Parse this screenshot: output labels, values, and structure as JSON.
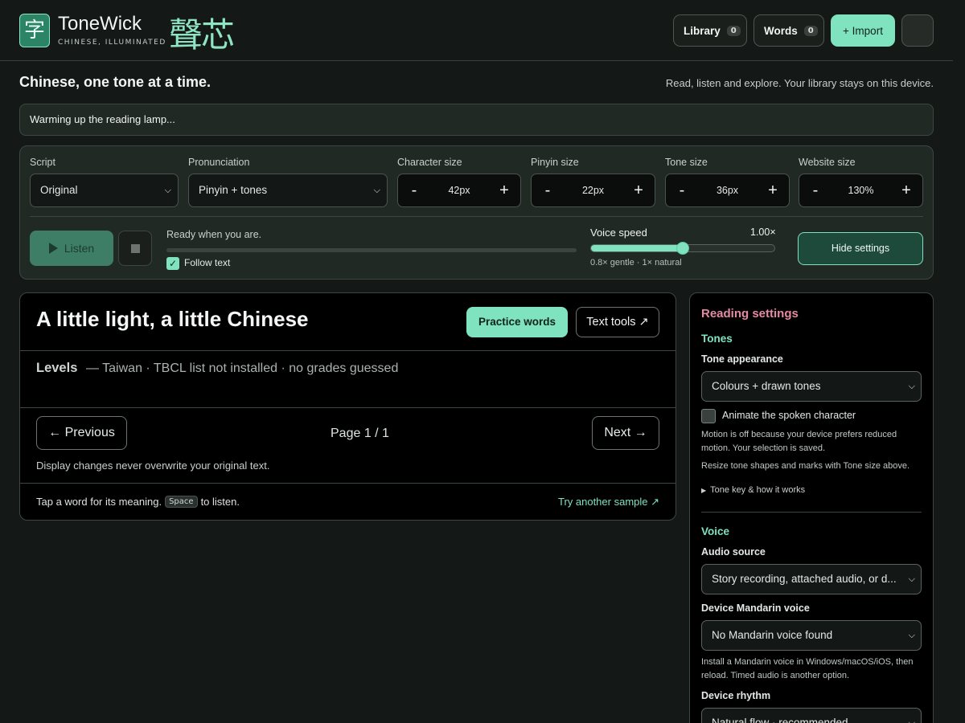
{
  "header": {
    "logo_glyph": "字",
    "brand_name": "ToneWick",
    "brand_tagline": "CHINESE, ILLUMINATED",
    "brand_hanzi": "聲芯",
    "library": {
      "label": "Library",
      "count": "0"
    },
    "words": {
      "label": "Words",
      "count": "0"
    },
    "import_label": "+ Import"
  },
  "intro": {
    "tagline": "Chinese, one tone at a time.",
    "subtagline": "Read, listen and explore. Your library stays on this device.",
    "status": "Warming up the reading lamp..."
  },
  "settings": {
    "script": {
      "label": "Script",
      "value": "Original"
    },
    "pronunciation": {
      "label": "Pronunciation",
      "value": "Pinyin + tones"
    },
    "character_size": {
      "label": "Character size",
      "value": "42px"
    },
    "pinyin_size": {
      "label": "Pinyin size",
      "value": "22px"
    },
    "tone_size": {
      "label": "Tone size",
      "value": "36px"
    },
    "website_size": {
      "label": "Website size",
      "value": "130%"
    },
    "listen_label": "Listen",
    "ready_text": "Ready when you are.",
    "playback_progress": 0,
    "follow_text": {
      "label": "Follow text",
      "checked": true
    },
    "voice_speed": {
      "label": "Voice speed",
      "display": "1.00×",
      "value": 1.0,
      "min": 0.5,
      "max": 1.5
    },
    "speed_hint": "0.8× gentle · 1× natural",
    "hide_label": "Hide settings"
  },
  "reader": {
    "title": "A little light, a little Chinese",
    "practice_label": "Practice words",
    "text_tools_label": "Text tools ↗",
    "levels_label": "Levels",
    "levels_text": "— Taiwan · TBCL list not installed · no grades guessed",
    "prev_label": "← Previous",
    "page_indicator": "Page 1 / 1",
    "next_label": "Next →",
    "display_note": "Display changes never overwrite your original text.",
    "hint_before": "Tap a word for its meaning.",
    "hint_key": "Space",
    "hint_after": "to listen.",
    "try_sample": "Try another sample ↗"
  },
  "side": {
    "title": "Reading settings",
    "tones_heading": "Tones",
    "tone_appearance": {
      "label": "Tone appearance",
      "value": "Colours + drawn tones"
    },
    "animate": {
      "label": "Animate the spoken character",
      "checked": false
    },
    "motion_note": "Motion is off because your device prefers reduced motion. Your selection is saved.",
    "resize_note": "Resize tone shapes and marks with Tone size above.",
    "tone_key": "Tone key & how it works",
    "voice_heading": "Voice",
    "audio_source": {
      "label": "Audio source",
      "value": "Story recording, attached audio, or d..."
    },
    "device_voice": {
      "label": "Device Mandarin voice",
      "value": "No Mandarin voice found"
    },
    "voice_note": "Install a Mandarin voice in Windows/macOS/iOS, then reload. Timed audio is another option.",
    "device_rhythm": {
      "label": "Device rhythm",
      "value": "Natural flow · recommended"
    }
  },
  "colors": {
    "accent": "#7fe3bf",
    "accent_dark": "#1d4a3a",
    "side_title": "#e58aa3",
    "background": "#141816"
  }
}
